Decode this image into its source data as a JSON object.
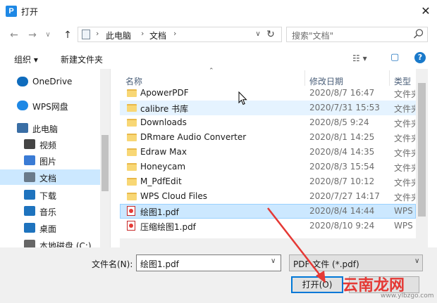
{
  "window": {
    "title": "打开",
    "app_icon": "P",
    "close": "✕"
  },
  "nav": {
    "back": "←",
    "forward": "→",
    "up": "↑",
    "dropdown": "∨",
    "breadcrumbs": [
      "此电脑",
      "文档"
    ],
    "refresh": "↻",
    "search_placeholder": "搜索\"文档\""
  },
  "toolbar": {
    "organize": "组织 ▾",
    "new_folder": "新建文件夹",
    "view": "☷ ▾",
    "pane": "▢",
    "help": "?"
  },
  "sidebar": {
    "items": [
      {
        "label": "OneDrive",
        "icon": "cloud-icon",
        "color": "#0f6cbd"
      },
      {
        "label": "WPS网盘",
        "icon": "wps-cloud-icon",
        "color": "#1e88e5"
      },
      {
        "label": "此电脑",
        "icon": "computer-icon",
        "color": "#3a6ea5"
      },
      {
        "label": "视频",
        "icon": "video-icon",
        "color": "#444"
      },
      {
        "label": "图片",
        "icon": "pictures-icon",
        "color": "#3a7bd5"
      },
      {
        "label": "文档",
        "icon": "documents-icon",
        "color": "#6a7a8a"
      },
      {
        "label": "下载",
        "icon": "download-icon",
        "color": "#1e73be"
      },
      {
        "label": "音乐",
        "icon": "music-icon",
        "color": "#1e73be"
      },
      {
        "label": "桌面",
        "icon": "desktop-icon",
        "color": "#1e73be"
      },
      {
        "label": "本地磁盘 (C:)",
        "icon": "drive-icon",
        "color": "#666"
      }
    ]
  },
  "columns": {
    "name": "名称",
    "date": "修改日期",
    "type": "类型"
  },
  "files": [
    {
      "name": "ApowerPDF",
      "date": "2020/8/7 16:47",
      "type": "文件夹",
      "kind": "folder"
    },
    {
      "name": "calibre 书库",
      "date": "2020/7/31 15:53",
      "type": "文件夹",
      "kind": "folder"
    },
    {
      "name": "Downloads",
      "date": "2020/8/5 9:24",
      "type": "文件夹",
      "kind": "folder"
    },
    {
      "name": "DRmare Audio Converter",
      "date": "2020/8/1 14:25",
      "type": "文件夹",
      "kind": "folder"
    },
    {
      "name": "Edraw Max",
      "date": "2020/8/4 14:35",
      "type": "文件夹",
      "kind": "folder"
    },
    {
      "name": "Honeycam",
      "date": "2020/8/3 15:54",
      "type": "文件夹",
      "kind": "folder"
    },
    {
      "name": "M_PdfEdit",
      "date": "2020/8/7 10:12",
      "type": "文件夹",
      "kind": "folder"
    },
    {
      "name": "WPS Cloud Files",
      "date": "2020/7/27 14:17",
      "type": "文件夹",
      "kind": "folder"
    },
    {
      "name": "绘图1.pdf",
      "date": "2020/8/4 14:44",
      "type": "WPS PD",
      "kind": "pdf"
    },
    {
      "name": "压缩绘图1.pdf",
      "date": "2020/8/10 9:24",
      "type": "WPS PD",
      "kind": "pdf"
    }
  ],
  "bottom": {
    "filename_label": "文件名(N):",
    "filename_value": "绘图1.pdf",
    "filetype_value": "PDF 文件 (*.pdf)",
    "open_label": "打开(O)"
  },
  "watermark": {
    "text": "云南龙网",
    "url": "www.ylbzgo.com"
  },
  "colors": {
    "selection": "#cce8ff",
    "hover": "#e5f3ff",
    "accent": "#0078d7",
    "arrow": "#e53935"
  }
}
